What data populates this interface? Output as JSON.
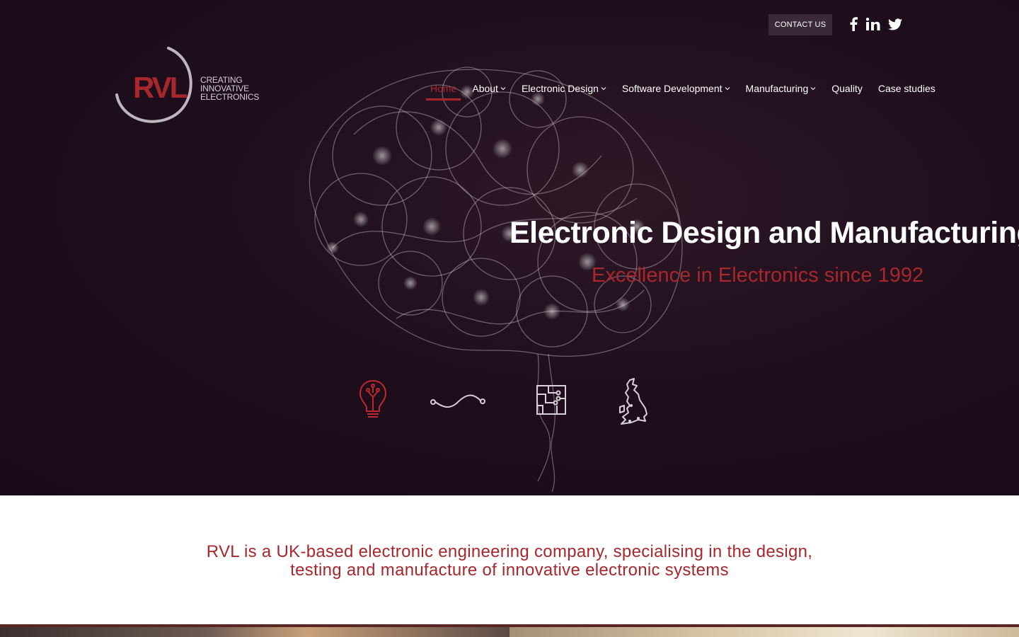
{
  "header": {
    "contact_label": "CONTACT US",
    "social": [
      {
        "icon": "facebook-icon"
      },
      {
        "icon": "linkedin-icon"
      },
      {
        "icon": "twitter-icon"
      }
    ]
  },
  "logo": {
    "mark": "RVL",
    "tagline": [
      "CREATING",
      "INNOVATIVE",
      "ELECTRONICS"
    ]
  },
  "nav": {
    "items": [
      {
        "label": "Home",
        "active": true,
        "dropdown": false
      },
      {
        "label": "About",
        "active": false,
        "dropdown": true
      },
      {
        "label": "Electronic Design",
        "active": false,
        "dropdown": true
      },
      {
        "label": "Software Development",
        "active": false,
        "dropdown": true
      },
      {
        "label": "Manufacturing",
        "active": false,
        "dropdown": true
      },
      {
        "label": "Quality",
        "active": false,
        "dropdown": false
      },
      {
        "label": "Case studies",
        "active": false,
        "dropdown": false
      }
    ]
  },
  "hero": {
    "title": "Electronic Design and Manufacturing",
    "subtitle": "Excellence in Electronics since 1992",
    "features": [
      {
        "icon": "lightbulb-icon"
      },
      {
        "icon": "wave-signal-icon"
      },
      {
        "icon": "circuit-board-icon"
      },
      {
        "icon": "uk-map-icon"
      }
    ]
  },
  "intro": {
    "line1": "RVL is a UK-based electronic engineering company, specialising in the design,",
    "line2": "testing and manufacture of innovative electronic systems"
  },
  "colors": {
    "accent": "#a8272d",
    "hero_bg": "#1f0f1d",
    "contact_bg": "#3a2a38"
  }
}
